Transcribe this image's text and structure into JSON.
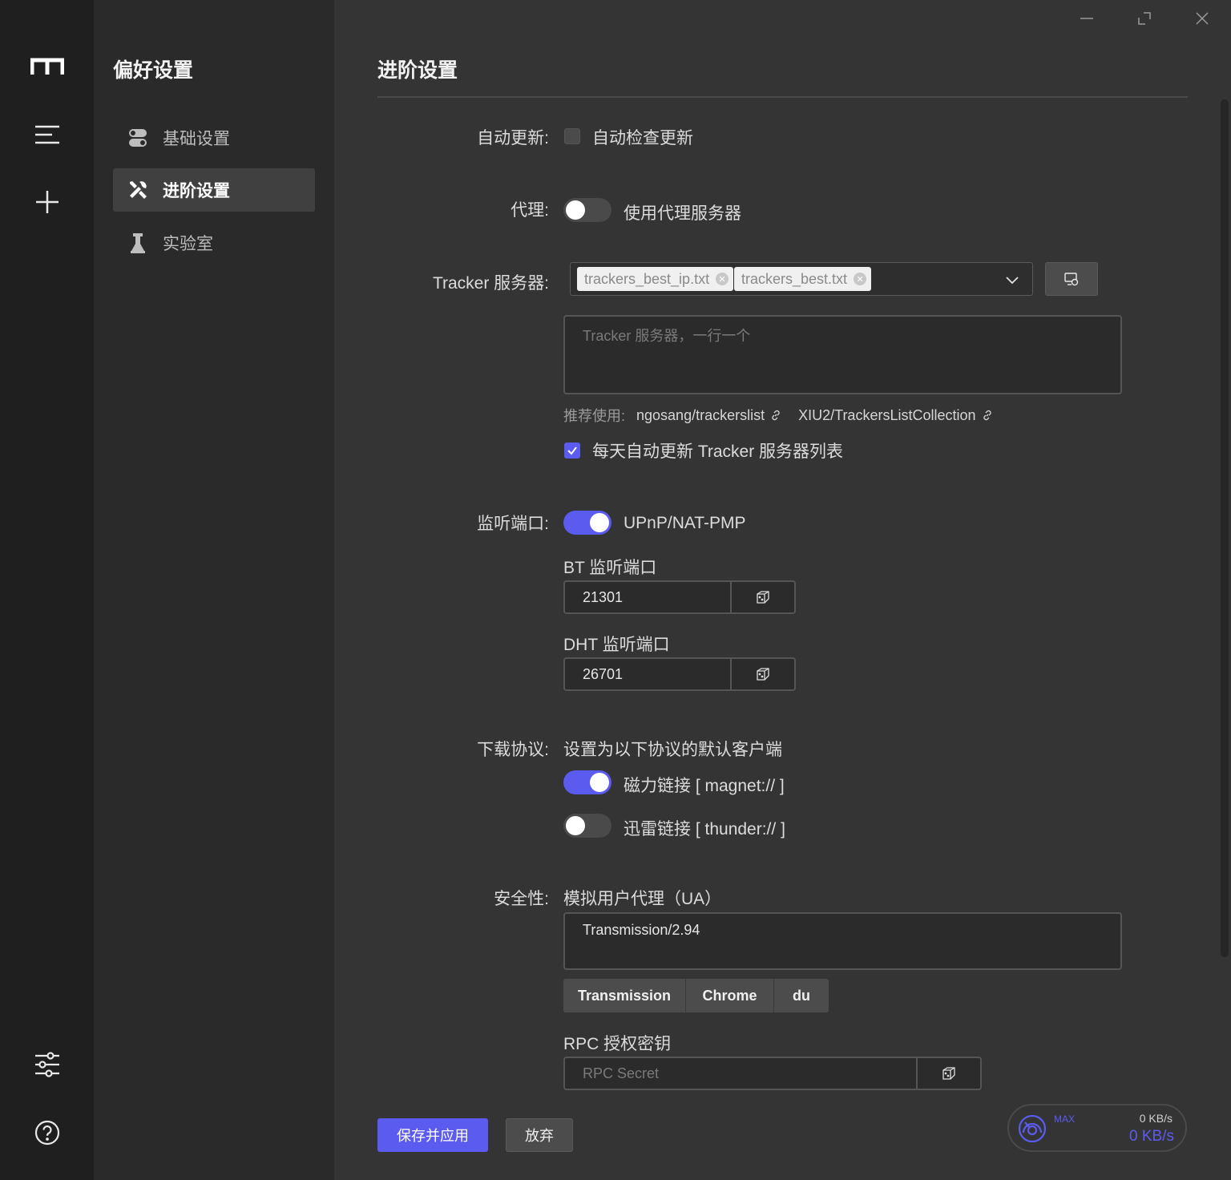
{
  "sidebar": {
    "title": "偏好设置",
    "items": [
      {
        "label": "基础设置",
        "icon": "toggles-icon",
        "active": false
      },
      {
        "label": "进阶设置",
        "icon": "tools-icon",
        "active": true
      },
      {
        "label": "实验室",
        "icon": "flask-icon",
        "active": false
      }
    ]
  },
  "rail": {
    "icons": [
      "logo-icon",
      "menu-icon",
      "add-icon",
      "sliders-icon",
      "help-icon"
    ]
  },
  "window": {
    "controls": [
      "minimize-icon",
      "maximize-icon",
      "close-icon"
    ]
  },
  "main": {
    "title": "进阶设置",
    "auto_update": {
      "label": "自动更新:",
      "checkbox_label": "自动检查更新",
      "checked": false
    },
    "proxy": {
      "label": "代理:",
      "switch_label": "使用代理服务器",
      "on": false
    },
    "tracker": {
      "label": "Tracker 服务器:",
      "tags": [
        "trackers_best_ip.txt",
        "trackers_best.txt"
      ],
      "textarea_placeholder": "Tracker 服务器，一行一个",
      "recommend_label": "推荐使用:",
      "links": [
        "ngosang/trackerslist",
        "XIU2/TrackersListCollection"
      ],
      "auto_sync_label": "每天自动更新 Tracker 服务器列表",
      "auto_sync_checked": true
    },
    "listen_port": {
      "label": "监听端口:",
      "upnp_label": "UPnP/NAT-PMP",
      "upnp_on": true,
      "bt_label": "BT 监听端口",
      "bt_value": "21301",
      "dht_label": "DHT 监听端口",
      "dht_value": "26701"
    },
    "protocol": {
      "label": "下载协议:",
      "desc": "设置为以下协议的默认客户端",
      "magnet_label": "磁力链接 [ magnet:// ]",
      "magnet_on": true,
      "thunder_label": "迅雷链接 [ thunder:// ]",
      "thunder_on": false
    },
    "security": {
      "label": "安全性:",
      "ua_label": "模拟用户代理（UA）",
      "ua_value": "Transmission/2.94",
      "ua_presets": [
        "Transmission",
        "Chrome",
        "du"
      ],
      "rpc_label": "RPC 授权密钥",
      "rpc_placeholder": "RPC Secret"
    },
    "actions": {
      "save": "保存并应用",
      "discard": "放弃"
    },
    "speed": {
      "max_label": "MAX",
      "upload": "0 KB/s",
      "download": "0 KB/s"
    }
  },
  "colors": {
    "accent": "#5b5bf0",
    "rail_bg": "#1f1f1f",
    "sidebar_bg": "#2a2a2a",
    "main_bg": "#343434"
  }
}
